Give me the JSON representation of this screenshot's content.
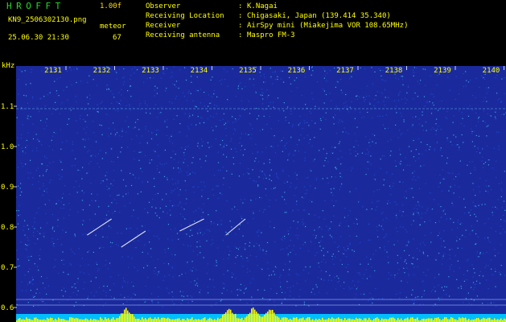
{
  "header": {
    "app_title": "HROFFT",
    "app_version": "1.00f",
    "file_name": "KN9_2506302130.png",
    "mode_label": "meteor",
    "datetime": "25.06.30 21:30",
    "count": "67",
    "info": [
      {
        "label": "Observer",
        "value": "K.Nagai"
      },
      {
        "label": "Receiving Location",
        "value": "Chigasaki, Japan (139.414 35.340)"
      },
      {
        "label": "Receiver",
        "value": "AirSpy mini (Miakejima VOR 108.65MHz)"
      },
      {
        "label": "Receiving antenna",
        "value": "Maspro FM-3"
      }
    ]
  },
  "chart_data": {
    "type": "heatmap",
    "ylabel": "kHz",
    "x_ticks": [
      "2131",
      "2132",
      "2133",
      "2134",
      "2135",
      "2136",
      "2137",
      "2138",
      "2139",
      "2140"
    ],
    "y_ticks": [
      "1.1",
      "1.0",
      "0.9",
      "0.8",
      "0.7",
      "0.6"
    ],
    "ylim": [
      0.58,
      1.2
    ],
    "trails": [
      {
        "t0": 2131.7,
        "f0": 0.78,
        "t1": 2132.2,
        "f1": 0.82
      },
      {
        "t0": 2132.4,
        "f0": 0.75,
        "t1": 2132.9,
        "f1": 0.79
      },
      {
        "t0": 2133.6,
        "f0": 0.79,
        "t1": 2134.1,
        "f1": 0.82
      },
      {
        "t0": 2134.55,
        "f0": 0.78,
        "t1": 2134.95,
        "f1": 0.82
      }
    ],
    "activity_peaks": [
      2132.5,
      2134.6,
      2135.1,
      2135.45
    ],
    "colors": {
      "background": "#1a2a9c",
      "noise_bright": "#3fa0e0",
      "noise_dim": "#2244cc",
      "trail": "#ffffff",
      "tick_label": "#ffff00",
      "activity": "#ffff00",
      "baseline": "#00bfff"
    }
  }
}
